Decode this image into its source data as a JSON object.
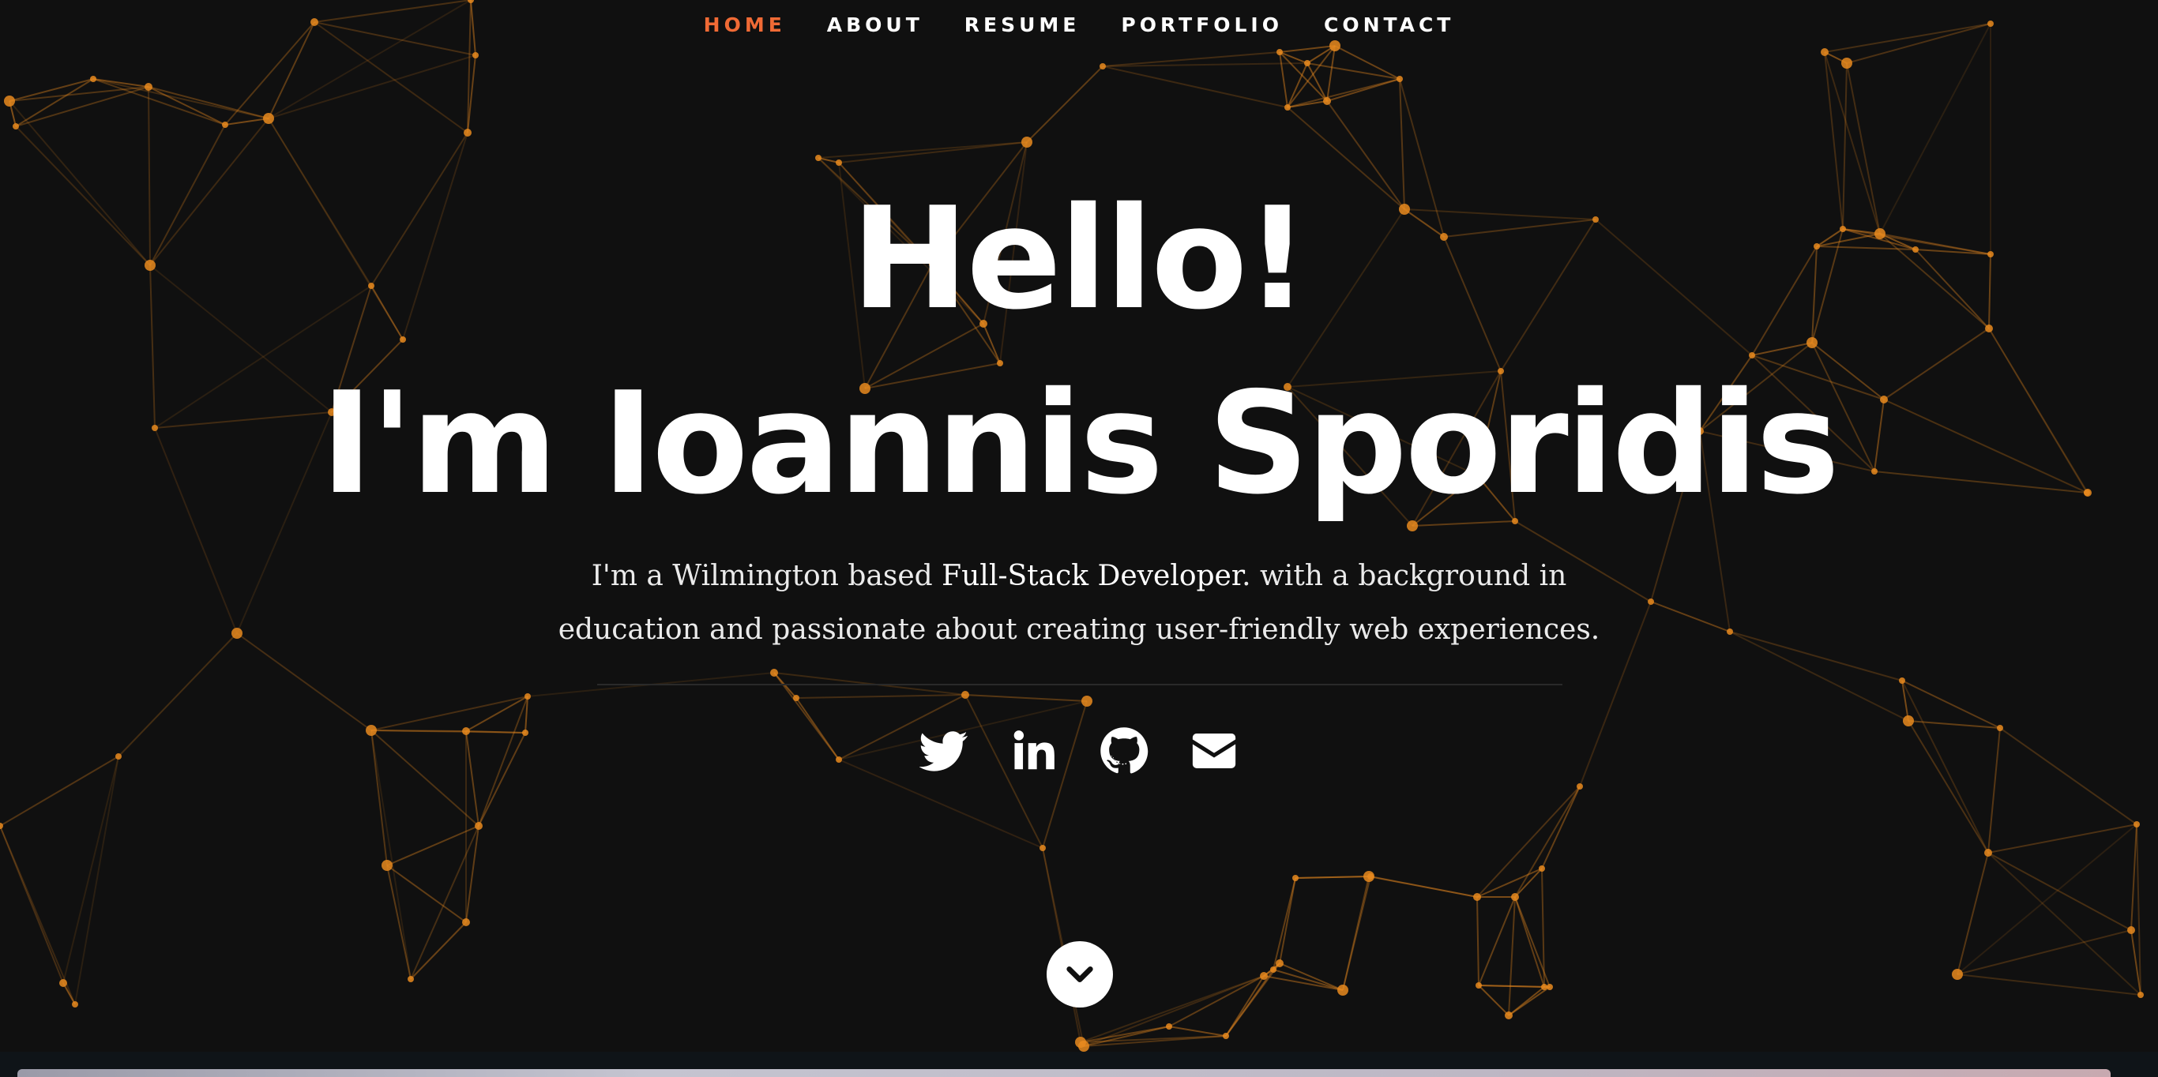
{
  "nav": {
    "items": [
      {
        "label": "HOME",
        "active": true
      },
      {
        "label": "ABOUT",
        "active": false
      },
      {
        "label": "RESUME",
        "active": false
      },
      {
        "label": "PORTFOLIO",
        "active": false
      },
      {
        "label": "CONTACT",
        "active": false
      }
    ],
    "active_color": "#f06a35"
  },
  "hero": {
    "greeting": "Hello!",
    "name_line": "I'm Ioannis Sporidis",
    "intro_part1": "I'm a Wilmington based ",
    "intro_emphasis": "Full-Stack Developer",
    "intro_part2": ". with a background in education and passionate about creating user-friendly web experiences."
  },
  "social": {
    "links": [
      {
        "name": "twitter-icon"
      },
      {
        "name": "linkedin-icon"
      },
      {
        "name": "github-icon"
      },
      {
        "name": "email-icon"
      }
    ]
  },
  "scroll_down": {
    "icon": "chevron-down-icon"
  },
  "colors": {
    "background": "#101010",
    "particle": "#e8891f",
    "text": "#ffffff"
  }
}
